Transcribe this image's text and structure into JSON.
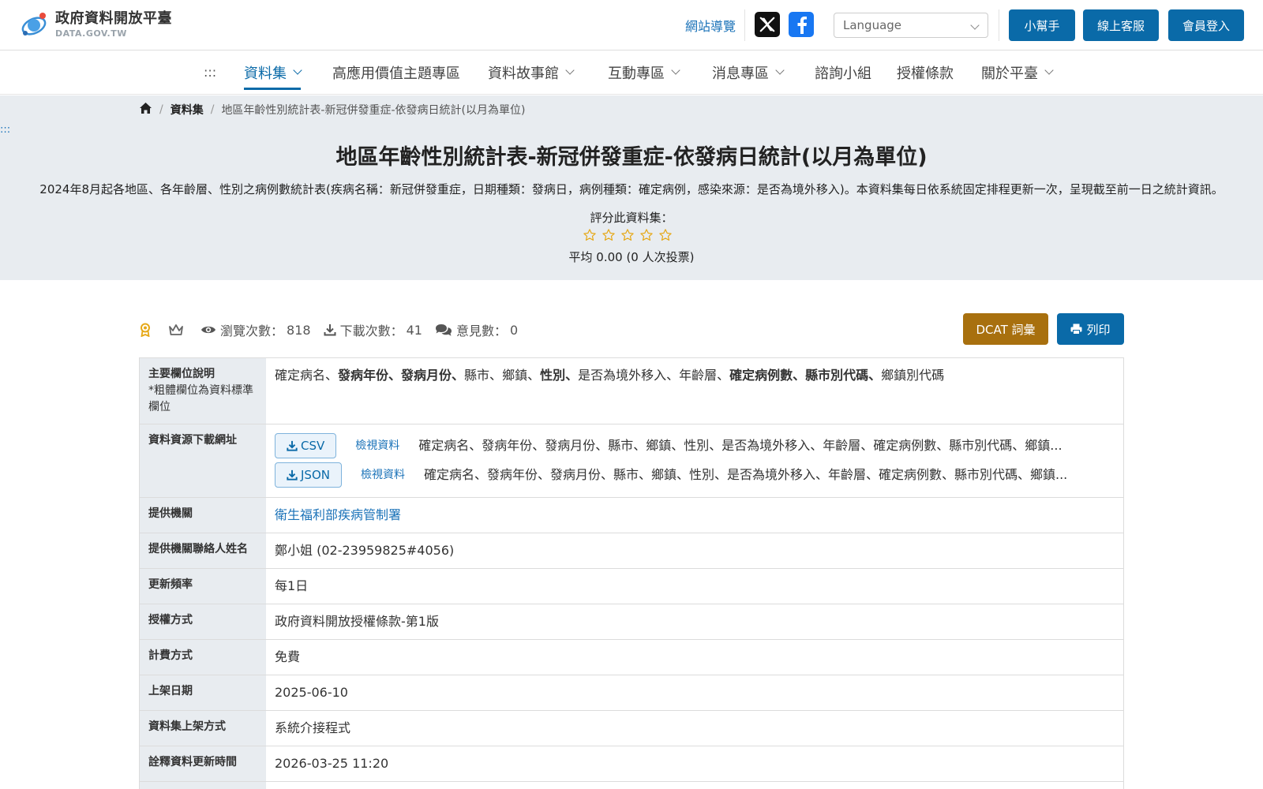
{
  "header": {
    "logo_title": "政府資料開放平臺",
    "logo_sub": "DATA.GOV.TW",
    "site_nav": "網站導覽",
    "language_placeholder": "Language",
    "buttons": {
      "helper": "小幫手",
      "support": "線上客服",
      "login": "會員登入"
    }
  },
  "nav": {
    "access_key": ":::",
    "items": [
      {
        "label": "資料集",
        "dropdown": true
      },
      {
        "label": "高應用價值主題專區",
        "dropdown": false
      },
      {
        "label": "資料故事館",
        "dropdown": true
      },
      {
        "label": "互動專區",
        "dropdown": true
      },
      {
        "label": "消息專區",
        "dropdown": true
      },
      {
        "label": "諮詢小組",
        "dropdown": false
      },
      {
        "label": "授權條款",
        "dropdown": false
      },
      {
        "label": "關於平臺",
        "dropdown": true
      }
    ]
  },
  "breadcrumb": {
    "level1": "資料集",
    "current": "地區年齡性別統計表-新冠併發重症-依發病日統計(以月為單位)"
  },
  "hero": {
    "access_key": ":::",
    "title": "地區年齡性別統計表-新冠併發重症-依發病日統計(以月為單位)",
    "description": "2024年8月起各地區、各年齡層、性別之病例數統計表(疾病名稱：新冠併發重症，日期種類：發病日，病例種類：確定病例，感染來源：是否為境外移入)。本資料集每日依系統固定排程更新一次，呈現截至前一日之統計資訊。",
    "rate_label": "評分此資料集：",
    "rating_average": "平均 0.00 (0 人次投票)"
  },
  "stats": {
    "views_label": "瀏覽次數：",
    "views": "818",
    "downloads_label": "下載次數：",
    "downloads": "41",
    "comments_label": "意見數：",
    "comments": "0"
  },
  "actions": {
    "dcat": "DCAT 詞彙",
    "print": "列印"
  },
  "table": {
    "fields": {
      "label": "主要欄位說明",
      "note": "*粗體欄位為資料標準欄位",
      "items": [
        {
          "text": "確定病名",
          "bold": false
        },
        {
          "text": "發病年份",
          "bold": true
        },
        {
          "text": "發病月份",
          "bold": true
        },
        {
          "text": "縣市",
          "bold": false
        },
        {
          "text": "鄉鎮",
          "bold": false
        },
        {
          "text": "性別",
          "bold": true
        },
        {
          "text": "是否為境外移入",
          "bold": false
        },
        {
          "text": "年齡層",
          "bold": false
        },
        {
          "text": "確定病例數",
          "bold": true
        },
        {
          "text": "縣市別代碼",
          "bold": true
        },
        {
          "text": "鄉鎮別代碼",
          "bold": false
        }
      ]
    },
    "downloads": {
      "label": "資料資源下載網址",
      "items": [
        {
          "format": "CSV",
          "view": "檢視資料",
          "desc": "確定病名、發病年份、發病月份、縣市、鄉鎮、性別、是否為境外移入、年齡層、確定病例數、縣市別代碼、鄉鎮..."
        },
        {
          "format": "JSON",
          "view": "檢視資料",
          "desc": "確定病名、發病年份、發病月份、縣市、鄉鎮、性別、是否為境外移入、年齡層、確定病例數、縣市別代碼、鄉鎮..."
        }
      ]
    },
    "provider": {
      "label": "提供機關",
      "value": "衛生福利部疾病管制署"
    },
    "contact": {
      "label": "提供機關聯絡人姓名",
      "value": "鄭小姐 (02-23959825#4056)"
    },
    "frequency": {
      "label": "更新頻率",
      "value": "每1日"
    },
    "license": {
      "label": "授權方式",
      "value": "政府資料開放授權條款-第1版"
    },
    "fee": {
      "label": "計費方式",
      "value": "免費"
    },
    "publish_date": {
      "label": "上架日期",
      "value": "2025-06-10"
    },
    "publish_method": {
      "label": "資料集上架方式",
      "value": "系統介接程式"
    },
    "meta_updated": {
      "label": "詮釋資料更新時間",
      "value": "2026-03-25 11:20"
    }
  },
  "colors": {
    "primary": "#0a6aa8",
    "dcat": "#a8700e",
    "hero_bg": "#e8ecf0",
    "star": "#e6a817"
  }
}
